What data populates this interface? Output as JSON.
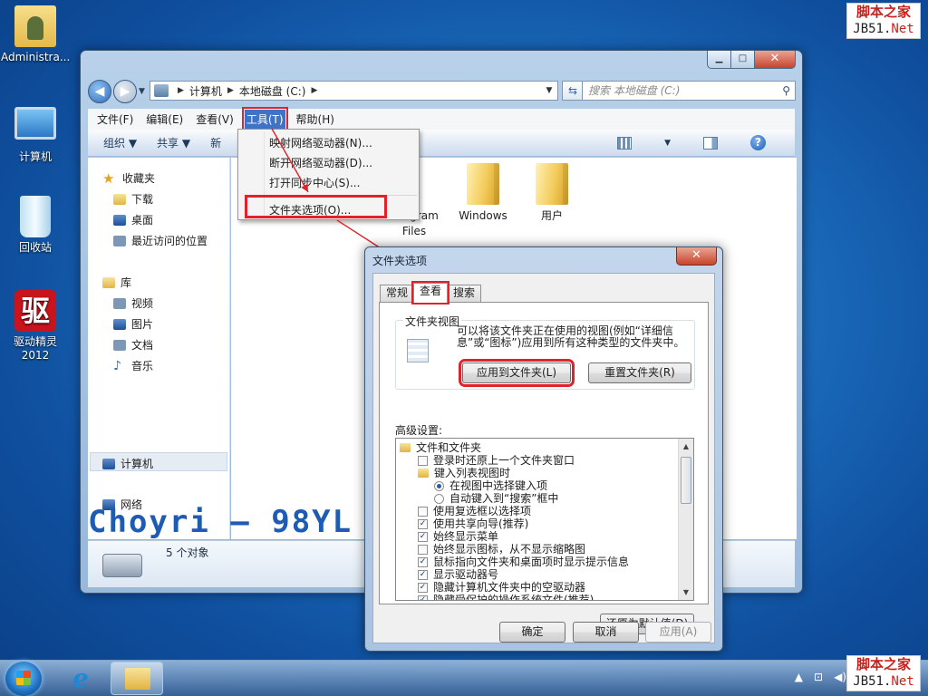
{
  "desktop": {
    "icons": [
      {
        "label": "Administra...",
        "icon": "user-folder-icon"
      },
      {
        "label": "计算机",
        "icon": "computer-icon"
      },
      {
        "label": "回收站",
        "icon": "recycle-bin-icon"
      },
      {
        "label": "驱动精灵",
        "sub": "2012",
        "glyph": "驱",
        "icon": "driver-genius-icon"
      }
    ],
    "logo": {
      "top": "脚本之家",
      "net_prefix": "JB51.",
      "net_suffix": "Net"
    }
  },
  "explorer": {
    "nav": {
      "back": "◀",
      "forward": "▶",
      "drop": "▼"
    },
    "address": {
      "parts": [
        "计算机",
        "本地磁盘 (C:)"
      ],
      "separator": "▶"
    },
    "search_placeholder": "搜索 本地磁盘 (C:)",
    "menu": [
      "文件(F)",
      "编辑(E)",
      "查看(V)",
      "工具(T)",
      "帮助(H)"
    ],
    "toolbar": {
      "organize": "组织 ▼",
      "share": "共享 ▼",
      "new": "新"
    },
    "nav_pane": {
      "favorites": "收藏夹",
      "downloads": "下载",
      "desktop": "桌面",
      "recent": "最近访问的位置",
      "libraries": "库",
      "videos": "视频",
      "pictures": "图片",
      "documents": "文档",
      "music": "音乐",
      "computer": "计算机",
      "network": "网络"
    },
    "folders": [
      {
        "name": "gram",
        "name2": "Files"
      },
      {
        "name": "Windows"
      },
      {
        "name": "用户"
      }
    ],
    "watermark": "Choyri — 98YL",
    "status": "5 个对象"
  },
  "tools_menu": {
    "items": [
      "映射网络驱动器(N)...",
      "断开网络驱动器(D)...",
      "打开同步中心(S)...",
      "文件夹选项(O)..."
    ]
  },
  "dialog": {
    "title": "文件夹选项",
    "tabs": [
      "常规",
      "查看",
      "搜索"
    ],
    "group_title": "文件夹视图",
    "group_desc": "可以将该文件夹正在使用的视图(例如“详细信息”或“图标”)应用到所有这种类型的文件夹中。",
    "apply_to_folders": "应用到文件夹(L)",
    "reset_folders": "重置文件夹(R)",
    "advanced_label": "高级设置:",
    "tree": [
      {
        "type": "folder",
        "text": "文件和文件夹",
        "indent": 0
      },
      {
        "type": "check",
        "checked": false,
        "text": "登录时还原上一个文件夹窗口",
        "indent": 1
      },
      {
        "type": "folder",
        "text": "键入列表视图时",
        "indent": 1
      },
      {
        "type": "radio",
        "checked": true,
        "text": "在视图中选择键入项",
        "indent": 2
      },
      {
        "type": "radio",
        "checked": false,
        "text": "自动键入到“搜索”框中",
        "indent": 2
      },
      {
        "type": "check",
        "checked": false,
        "text": "使用复选框以选择项",
        "indent": 1
      },
      {
        "type": "check",
        "checked": true,
        "text": "使用共享向导(推荐)",
        "indent": 1
      },
      {
        "type": "check",
        "checked": true,
        "text": "始终显示菜单",
        "indent": 1
      },
      {
        "type": "check",
        "checked": false,
        "text": "始终显示图标，从不显示缩略图",
        "indent": 1
      },
      {
        "type": "check",
        "checked": true,
        "text": "鼠标指向文件夹和桌面项时显示提示信息",
        "indent": 1
      },
      {
        "type": "check",
        "checked": true,
        "text": "显示驱动器号",
        "indent": 1
      },
      {
        "type": "check",
        "checked": true,
        "text": "隐藏计算机文件夹中的空驱动器",
        "indent": 1
      },
      {
        "type": "check",
        "checked": true,
        "text": "隐藏受保护的操作系统文件(推荐)",
        "indent": 1
      }
    ],
    "restore_defaults": "还原为默认值(D)",
    "ok": "确定",
    "cancel": "取消",
    "apply": "应用(A)"
  },
  "taskbar": {
    "tray": [
      "▲",
      "⊡",
      "◀)"
    ]
  },
  "colors": {
    "highlight_box": "#e0232b",
    "menu_hot": "#3f73c6"
  }
}
